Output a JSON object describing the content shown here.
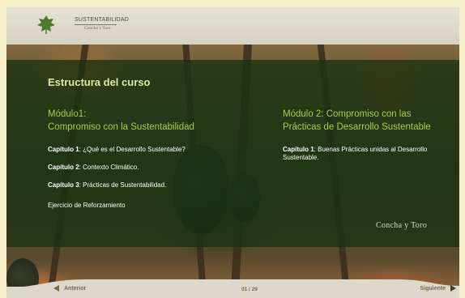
{
  "header": {
    "logo_title": "SUSTENTABILIDAD",
    "logo_subtitle": "Concha y Toro"
  },
  "main": {
    "course_title": "Estructura del curso",
    "module1": {
      "title_line1": "Módulo1:",
      "title_line2": "Compromiso con la Sustentabilidad",
      "chapters": [
        {
          "label": "Capítulo 1",
          "text": ": ¿Qué es el Desarrollo Sustentable?"
        },
        {
          "label": "Capítulo 2",
          "text": ": Contexto Climático."
        },
        {
          "label": "Capítulo 3",
          "text": ": Prácticas de Sustentabilidad."
        }
      ],
      "exercise": "Ejercicio de Reforzamiento"
    },
    "module2": {
      "title_line1": "Módulo 2: Compromiso con las",
      "title_line2": "Prácticas de Desarrollo Sustentable",
      "chapters": [
        {
          "label": "Capítulo 1",
          "text": ": Buenas Prácticas unidas al Desarrollo Sustentable."
        }
      ]
    },
    "brand": "Concha y Toro"
  },
  "footer": {
    "prev_label": "Anterior",
    "next_label": "Siguiente",
    "page": "01 / 29"
  },
  "colors": {
    "accent_green": "#a9cf48",
    "title_green": "#dde8a0",
    "overlay": "#1c3212",
    "nav_text": "#6e7040"
  }
}
